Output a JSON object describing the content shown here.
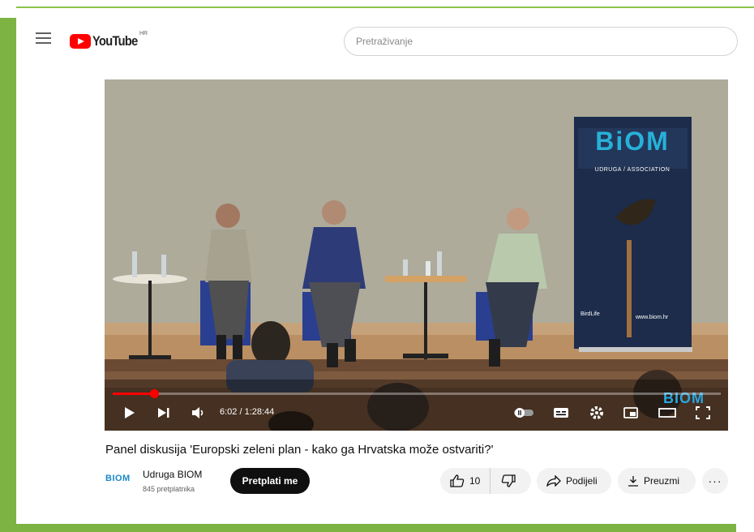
{
  "header": {
    "logo_text": "YouTube",
    "region": "HR",
    "search_placeholder": "Pretraživanje"
  },
  "player": {
    "time": "6:02 / 1:28:44",
    "progress": 0.068,
    "banner": {
      "brand": "BiOM",
      "subtitle": "UDRUGA / ASSOCIATION",
      "partner": "BirdLife",
      "url": "www.biom.hr"
    },
    "watermark": "BIOM"
  },
  "video": {
    "title": "Panel diskusija 'Europski zeleni plan - kako ga Hrvatska može ostvariti?'"
  },
  "channel": {
    "logo_text": "BIOM",
    "name": "Udruga BIOM",
    "subscribers": "845 pretplatnika",
    "subscribe_label": "Pretplati me"
  },
  "actions": {
    "likes": "10",
    "share_label": "Podijeli",
    "download_label": "Preuzmi",
    "more_label": "···"
  },
  "colors": {
    "frame": "#7cb342",
    "youtube_red": "#ff0000",
    "biom_blue": "#1a88c9"
  }
}
